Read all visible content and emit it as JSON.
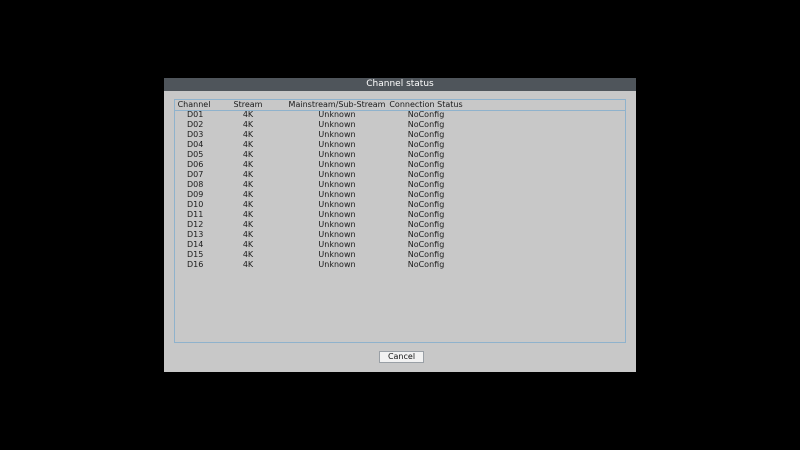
{
  "dialog": {
    "title": "Channel status",
    "cancel_label": "Cancel"
  },
  "table": {
    "headers": [
      "Channel",
      "Stream",
      "Mainstream/Sub-Stream",
      "Connection Status"
    ],
    "rows": [
      [
        "D01",
        "4K",
        "Unknown",
        "NoConfig"
      ],
      [
        "D02",
        "4K",
        "Unknown",
        "NoConfig"
      ],
      [
        "D03",
        "4K",
        "Unknown",
        "NoConfig"
      ],
      [
        "D04",
        "4K",
        "Unknown",
        "NoConfig"
      ],
      [
        "D05",
        "4K",
        "Unknown",
        "NoConfig"
      ],
      [
        "D06",
        "4K",
        "Unknown",
        "NoConfig"
      ],
      [
        "D07",
        "4K",
        "Unknown",
        "NoConfig"
      ],
      [
        "D08",
        "4K",
        "Unknown",
        "NoConfig"
      ],
      [
        "D09",
        "4K",
        "Unknown",
        "NoConfig"
      ],
      [
        "D10",
        "4K",
        "Unknown",
        "NoConfig"
      ],
      [
        "D11",
        "4K",
        "Unknown",
        "NoConfig"
      ],
      [
        "D12",
        "4K",
        "Unknown",
        "NoConfig"
      ],
      [
        "D13",
        "4K",
        "Unknown",
        "NoConfig"
      ],
      [
        "D14",
        "4K",
        "Unknown",
        "NoConfig"
      ],
      [
        "D15",
        "4K",
        "Unknown",
        "NoConfig"
      ],
      [
        "D16",
        "4K",
        "Unknown",
        "NoConfig"
      ]
    ]
  },
  "colors": {
    "background": "#000000",
    "dialog_bg": "#c8c8c8",
    "titlebar_bg": "#4f555b",
    "border_accent": "#8fb2cc"
  }
}
